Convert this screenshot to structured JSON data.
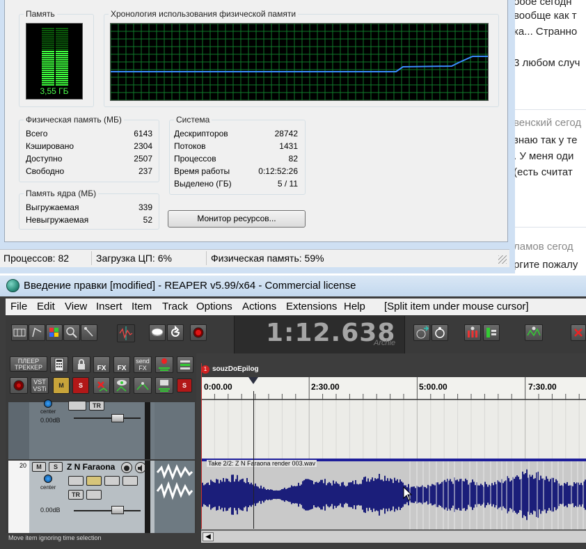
{
  "webpage": {
    "lines": [
      "oooe сегодн",
      "вообще как т",
      "ка... Странно",
      "3 любом случ",
      "венский",
      "сегод",
      "знаю так у те",
      ". У меня оди",
      "(есть считат",
      "ламов",
      "сегод",
      "ргите пожалу"
    ]
  },
  "taskmgr": {
    "memory": {
      "title": "Память",
      "value": "3,55 ГБ",
      "fill_fraction": 0.59
    },
    "history": {
      "title": "Хронология использования физической памяти"
    },
    "physical": {
      "title": "Физическая память (МБ)",
      "rows": [
        {
          "k": "Всего",
          "v": "6143"
        },
        {
          "k": "Кэшировано",
          "v": "2304"
        },
        {
          "k": "Доступно",
          "v": "2507"
        },
        {
          "k": "Свободно",
          "v": "237"
        }
      ]
    },
    "kernel": {
      "title": "Память ядра (МБ)",
      "rows": [
        {
          "k": "Выгружаемая",
          "v": "339"
        },
        {
          "k": "Невыгружаемая",
          "v": "52"
        }
      ]
    },
    "system": {
      "title": "Система",
      "rows": [
        {
          "k": "Дескрипторов",
          "v": "28742"
        },
        {
          "k": "Потоков",
          "v": "1431"
        },
        {
          "k": "Процессов",
          "v": "82"
        },
        {
          "k": "Время работы",
          "v": "0:12:52:26"
        },
        {
          "k": "Выделено (ГБ)",
          "v": "5 / 11"
        }
      ]
    },
    "monitor_button": "Монитор ресурсов...",
    "status": {
      "processes": "Процессов: 82",
      "cpu": "Загрузка ЦП: 6%",
      "memory": "Физическая память: 59%"
    }
  },
  "reaper": {
    "title": "Введение правки [modified] - REAPER v5.99/x64 - Commercial license",
    "menu": [
      "File",
      "Edit",
      "View",
      "Insert",
      "Item",
      "Track",
      "Options",
      "Actions",
      "Extensions",
      "Help",
      "[Split item under mouse cursor]"
    ],
    "time": "1:12.638",
    "time_label": "Archie",
    "tcp": {
      "player_btn": "ПЛЕЕР\nТРЕККЕР",
      "send_btn": "send\nFX",
      "fx_btn": "FX",
      "vst_btn": "VST\nVSTi",
      "m_btn": "M",
      "s_btn": "S"
    },
    "track1": {
      "pan": "center",
      "vol": "0.00dB",
      "tr": "TR"
    },
    "track2": {
      "number": "20",
      "name": "Z N Faraona",
      "m": "M",
      "s": "S",
      "pan": "center",
      "vol": "0.00dB",
      "tr": "TR"
    },
    "marker": {
      "number": "1",
      "name": "souzDoEpilog"
    },
    "ruler": [
      "0:00.00",
      "2:30.00",
      "5:00.00",
      "7:30.00"
    ],
    "item": "Take 2/2: Z N Faraona render 003.wav",
    "hint": "Move item ignoring time selection"
  }
}
